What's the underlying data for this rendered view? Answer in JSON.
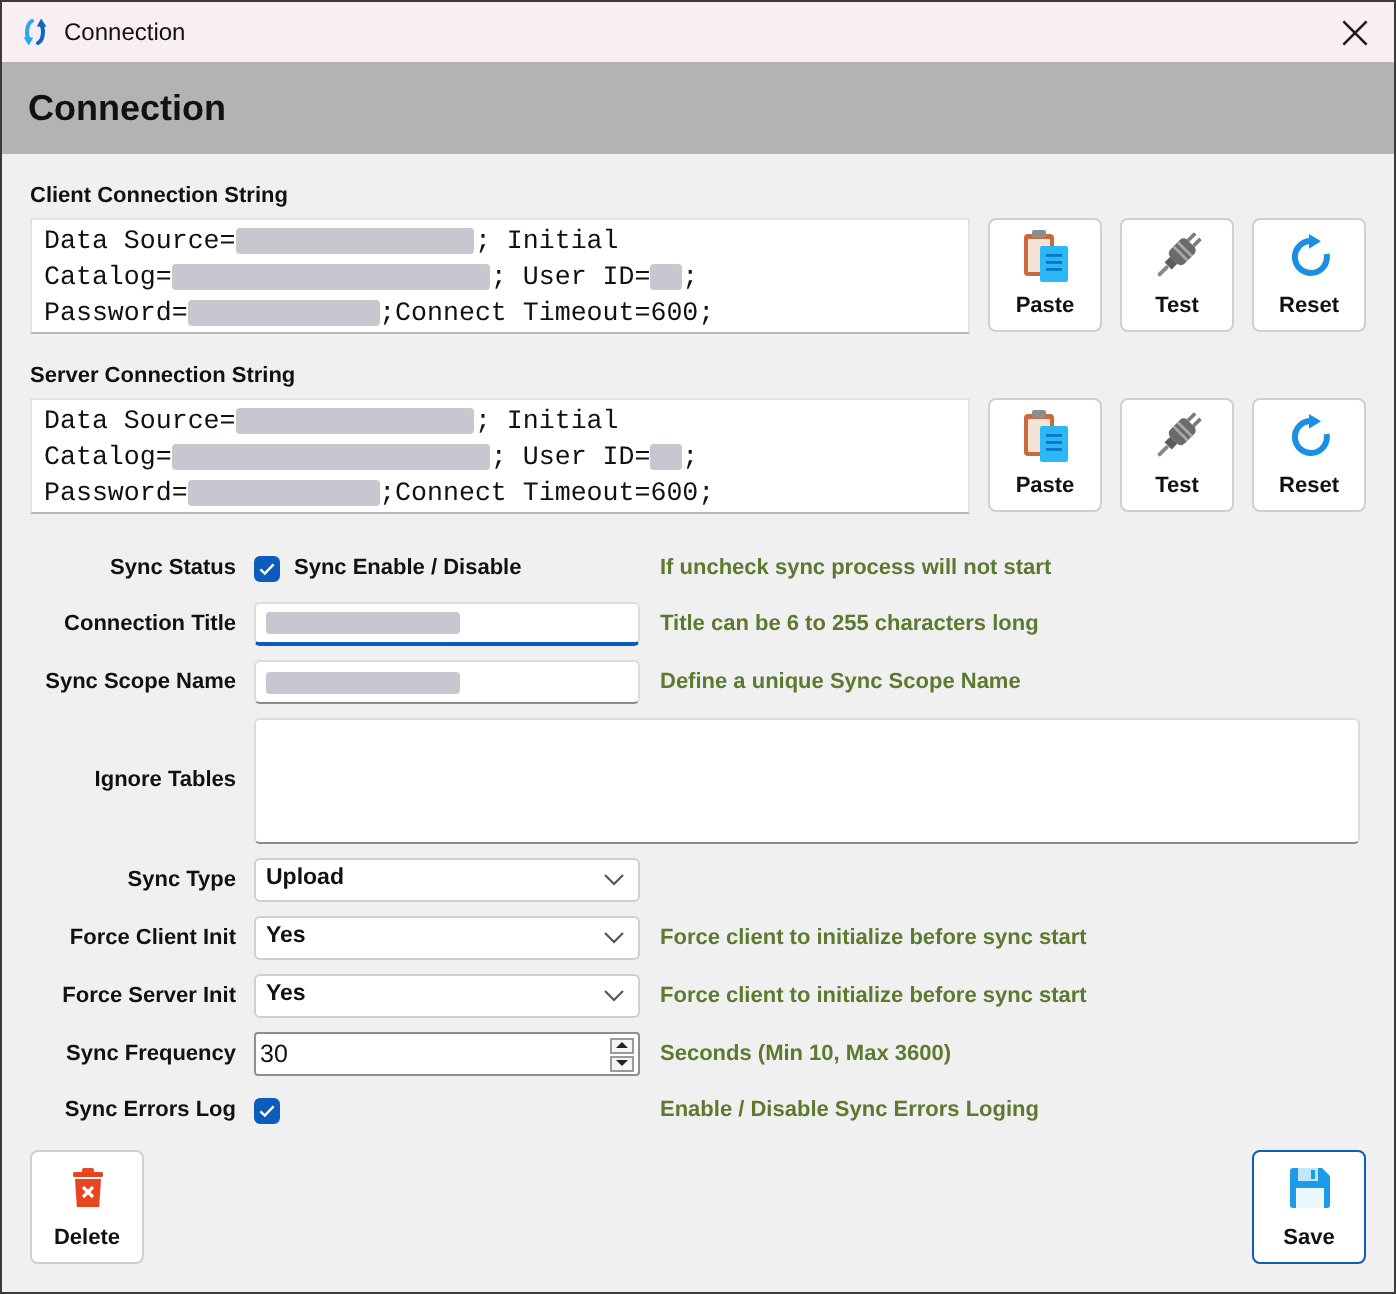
{
  "window": {
    "title": "Connection"
  },
  "header": {
    "title": "Connection"
  },
  "connections": [
    {
      "label": "Client Connection String",
      "lines": [
        [
          {
            "kind": "text",
            "text": "Data Source="
          },
          {
            "kind": "redacted_long"
          },
          {
            "kind": "text",
            "text": "; Initial"
          }
        ],
        [
          {
            "kind": "text",
            "text": "Catalog="
          },
          {
            "kind": "redacted_longest"
          },
          {
            "kind": "text",
            "text": "; User ID="
          },
          {
            "kind": "redacted_short"
          },
          {
            "kind": "text",
            "text": ";"
          }
        ],
        [
          {
            "kind": "text",
            "text": "Password="
          },
          {
            "kind": "redacted_medium"
          },
          {
            "kind": "text",
            "text": ";Connect Timeout=600;"
          }
        ]
      ],
      "buttons": [
        {
          "kind": "paste",
          "label": "Paste"
        },
        {
          "kind": "test",
          "label": "Test"
        },
        {
          "kind": "reset",
          "label": "Reset"
        }
      ]
    },
    {
      "label": "Server Connection String",
      "lines": [
        [
          {
            "kind": "text",
            "text": "Data Source="
          },
          {
            "kind": "redacted_long"
          },
          {
            "kind": "text",
            "text": "; Initial"
          }
        ],
        [
          {
            "kind": "text",
            "text": "Catalog="
          },
          {
            "kind": "redacted_longest"
          },
          {
            "kind": "text",
            "text": "; User ID="
          },
          {
            "kind": "redacted_short"
          },
          {
            "kind": "text",
            "text": ";"
          }
        ],
        [
          {
            "kind": "text",
            "text": "Password="
          },
          {
            "kind": "redacted_medium"
          },
          {
            "kind": "text",
            "text": ";Connect Timeout=600;"
          }
        ]
      ],
      "buttons": [
        {
          "kind": "paste",
          "label": "Paste"
        },
        {
          "kind": "test",
          "label": "Test"
        },
        {
          "kind": "reset",
          "label": "Reset"
        }
      ]
    }
  ],
  "form": [
    {
      "kind": "checkbox",
      "label": "Sync Status",
      "checked": true,
      "text": "Sync Enable / Disable",
      "hint": "If uncheck sync process will not start"
    },
    {
      "kind": "text",
      "label": "Connection Title",
      "redacted": true,
      "focused": true,
      "hint": "Title can be 6 to 255 characters long"
    },
    {
      "kind": "text",
      "label": "Sync Scope Name",
      "redacted": true,
      "focused": false,
      "hint": "Define a unique Sync Scope Name"
    },
    {
      "kind": "textarea",
      "label": "Ignore Tables"
    },
    {
      "kind": "select",
      "label": "Sync Type",
      "value": "Upload"
    },
    {
      "kind": "select",
      "label": "Force Client Init",
      "value": "Yes",
      "hint": "Force client to initialize before sync start"
    },
    {
      "kind": "select",
      "label": "Force Server Init",
      "value": "Yes",
      "hint": "Force client to initialize before sync start"
    },
    {
      "kind": "number",
      "label": "Sync Frequency",
      "value": "30",
      "hint": "Seconds (Min 10, Max 3600)"
    },
    {
      "kind": "checkbox",
      "label": "Sync Errors Log",
      "checked": true,
      "hint": "Enable / Disable Sync Errors Loging"
    }
  ],
  "footer": {
    "buttons": [
      {
        "kind": "delete",
        "label": "Delete",
        "focused": false
      },
      {
        "kind": "save",
        "label": "Save",
        "focused": true
      }
    ]
  }
}
